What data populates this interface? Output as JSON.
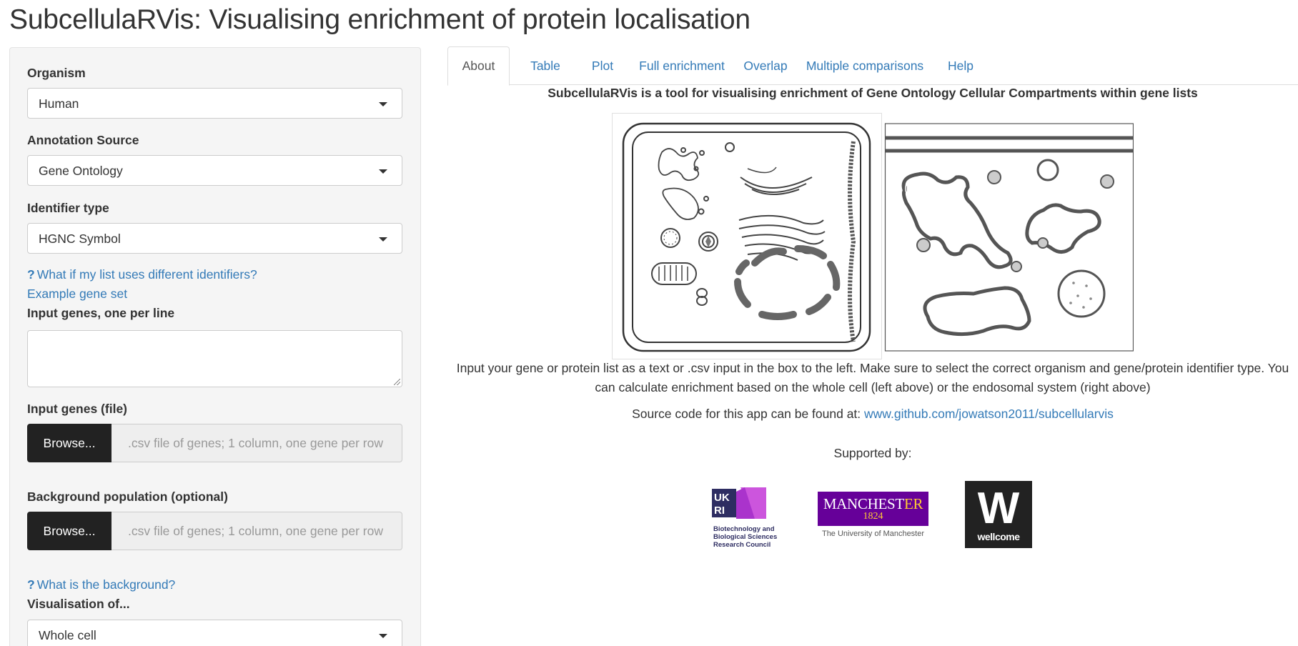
{
  "app": {
    "title": "SubcellulaRVis: Visualising enrichment of protein localisation"
  },
  "sidebar": {
    "organism": {
      "label": "Organism",
      "value": "Human"
    },
    "annotation_source": {
      "label": "Annotation Source",
      "value": "Gene Ontology"
    },
    "identifier_type": {
      "label": "Identifier type",
      "value": "HGNC Symbol"
    },
    "identifiers_help": "What if my list uses different identifiers?",
    "example_link": "Example gene set",
    "input_genes_label": "Input genes, one per line",
    "input_genes_value": "",
    "input_file": {
      "label": "Input genes (file)",
      "button": "Browse...",
      "placeholder": ".csv file of genes; 1 column, one gene per row"
    },
    "background_file": {
      "label": "Background population (optional)",
      "button": "Browse...",
      "placeholder": ".csv file of genes; 1 column, one gene per row"
    },
    "background_help": "What is the background?",
    "visualisation": {
      "label": "Visualisation of...",
      "value": "Whole cell"
    }
  },
  "tabs": [
    {
      "label": "About",
      "active": true
    },
    {
      "label": "Table",
      "active": false
    },
    {
      "label": "Plot",
      "active": false
    },
    {
      "label": "Full enrichment",
      "active": false
    },
    {
      "label": "Overlap",
      "active": false
    },
    {
      "label": "Multiple comparisons",
      "active": false
    },
    {
      "label": "Help",
      "active": false
    }
  ],
  "about": {
    "heading": "SubcellulaRVis is a tool for visualising enrichment of Gene Ontology Cellular Compartments within gene lists",
    "description": "Input your gene or protein list as a text or .csv input in the box to the left. Make sure to select the correct organism and gene/protein identifier type. You can calculate enrichment based on the whole cell (left above) or the endosomal system (right above)",
    "source_prefix": "Source code for this app can be found at:",
    "source_link": "www.github.com/jowatson2011/subcellularvis",
    "supported_by": "Supported by:"
  },
  "logos": {
    "ukri_mark": "UK RI",
    "ukri_text": [
      "Biotechnology and",
      "Biological Sciences",
      "Research Council"
    ],
    "manchester_name": "MANCHEST",
    "manchester_name_accent": "ER",
    "manchester_year": "1824",
    "manchester_sub": "The University of Manchester",
    "wellcome_mark": "W",
    "wellcome_text": "wellcome"
  },
  "colors": {
    "link": "#337ab7",
    "sidebar_bg": "#f5f5f5",
    "browse_bg": "#222222",
    "manchester_purple": "#660099",
    "ukri_purple": "#2e2d62",
    "bbsrc_pink": "#cc55dd"
  }
}
